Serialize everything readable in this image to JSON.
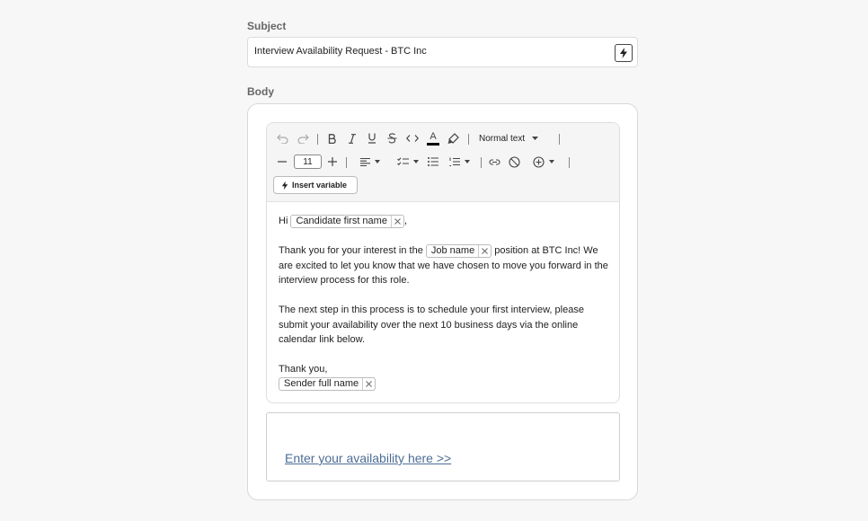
{
  "subject": {
    "label": "Subject",
    "value": "Interview Availability Request - BTC Inc",
    "action_icon": "bolt-icon"
  },
  "body": {
    "label": "Body",
    "toolbar": {
      "text_style": "Normal text",
      "font_size": "11",
      "insert_variable_label": "Insert variable",
      "text_color": "#000000"
    },
    "content": {
      "greeting": "Hi",
      "greeting_var": "Candidate first name",
      "greeting_end": ",",
      "para1_pre": "Thank you for your interest in the",
      "para1_var": "Job name",
      "para1_post": "position at BTC Inc! We are excited to let you know that we have chosen to move you forward in the interview process for this role.",
      "para2": "The next step in this process is to schedule your first interview, please submit your availability over the next 10 business days via the online calendar link below.",
      "signoff": "Thank you,",
      "signoff_var": "Sender full name"
    },
    "link": {
      "text": "Enter your availability here >>",
      "color": "#4d6d95"
    }
  }
}
